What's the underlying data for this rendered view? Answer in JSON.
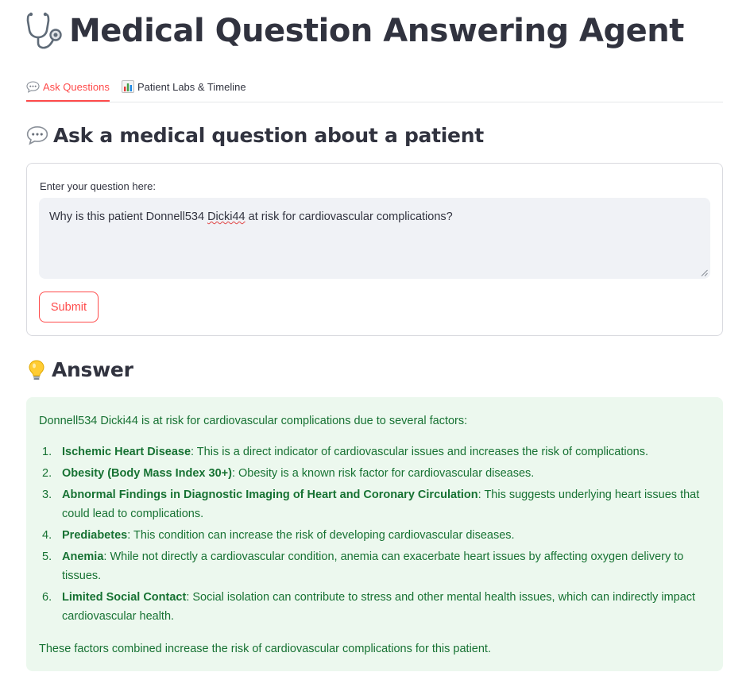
{
  "app": {
    "title": "Medical Question Answering Agent",
    "title_icon": "stethoscope-icon"
  },
  "tabs": [
    {
      "icon": "speech-bubble-icon",
      "label": "Ask Questions",
      "active": true
    },
    {
      "icon": "bar-chart-icon",
      "label": "Patient Labs & Timeline",
      "active": false
    }
  ],
  "ask": {
    "heading": "Ask a medical question about a patient",
    "heading_icon": "speech-bubble-icon",
    "label": "Enter your question here:",
    "question_pre": "Why is this patient Donnell534 ",
    "question_misspelled": "Dicki44",
    "question_post": " at risk for cardiovascular complications?",
    "submit_label": "Submit"
  },
  "answer": {
    "heading": "Answer",
    "heading_icon": "lightbulb-icon",
    "intro": "Donnell534 Dicki44 is at risk for cardiovascular complications due to several factors:",
    "items": [
      {
        "num": "1.",
        "title": "Ischemic Heart Disease",
        "text": ": This is a direct indicator of cardiovascular issues and increases the risk of complications."
      },
      {
        "num": "2.",
        "title": "Obesity (Body Mass Index 30+)",
        "text": ": Obesity is a known risk factor for cardiovascular diseases."
      },
      {
        "num": "3.",
        "title": "Abnormal Findings in Diagnostic Imaging of Heart and Coronary Circulation",
        "text": ": This suggests underlying heart issues that could lead to complications."
      },
      {
        "num": "4.",
        "title": "Prediabetes",
        "text": ": This condition can increase the risk of developing cardiovascular diseases."
      },
      {
        "num": "5.",
        "title": "Anemia",
        "text": ": While not directly a cardiovascular condition, anemia can exacerbate heart issues by affecting oxygen delivery to tissues."
      },
      {
        "num": "6.",
        "title": "Limited Social Contact",
        "text": ": Social isolation can contribute to stress and other mental health issues, which can indirectly impact cardiovascular health."
      }
    ],
    "outro": "These factors combined increase the risk of cardiovascular complications for this patient."
  },
  "colors": {
    "accent": "#ff4b4b",
    "text": "#31333f",
    "success_bg": "#ecf8ee",
    "success_text": "#177233",
    "input_bg": "#f0f2f6"
  }
}
